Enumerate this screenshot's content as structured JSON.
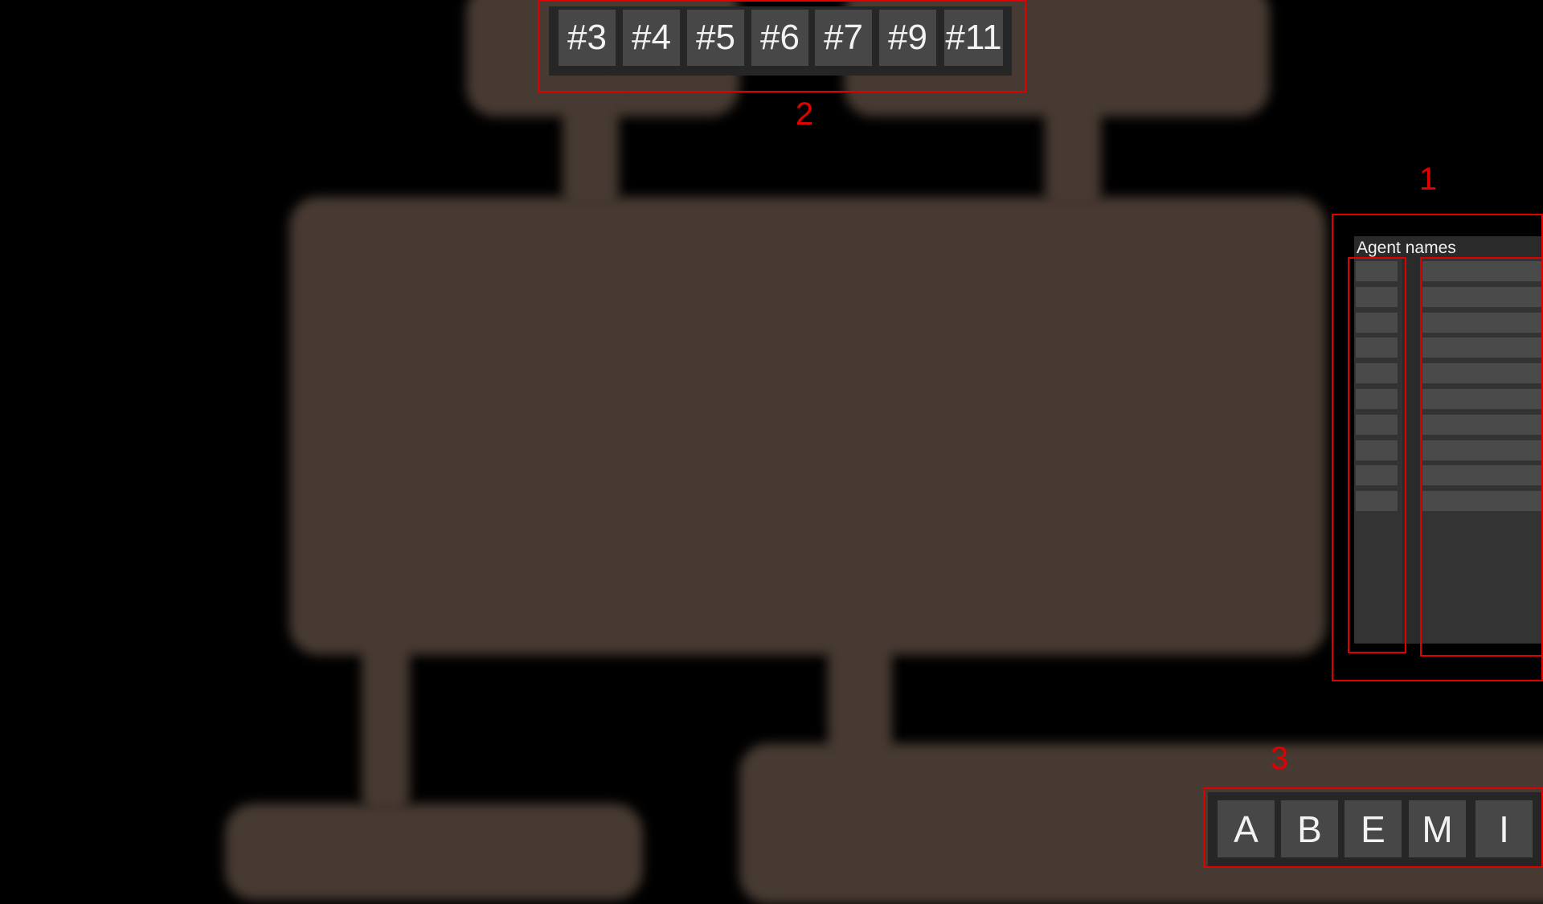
{
  "toolbar": {
    "buttons": [
      {
        "label": "#3"
      },
      {
        "label": "#4"
      },
      {
        "label": "#5"
      },
      {
        "label": "#6"
      },
      {
        "label": "#7"
      },
      {
        "label": "#9"
      },
      {
        "label": "#11"
      }
    ]
  },
  "agent_panel": {
    "title": "Agent names",
    "row_count": 10
  },
  "letter_bar": {
    "buttons": [
      {
        "label": "A"
      },
      {
        "label": "B"
      },
      {
        "label": "E"
      },
      {
        "label": "M"
      },
      {
        "label": "I"
      }
    ]
  },
  "annotations": {
    "agent_panel": "1",
    "toolbar": "2",
    "letter_bar": "3"
  },
  "colors": {
    "background": "#000000",
    "floor": "#473a32",
    "panel": "#2a2a2a",
    "button": "#474747",
    "annotation": "#e00000"
  }
}
